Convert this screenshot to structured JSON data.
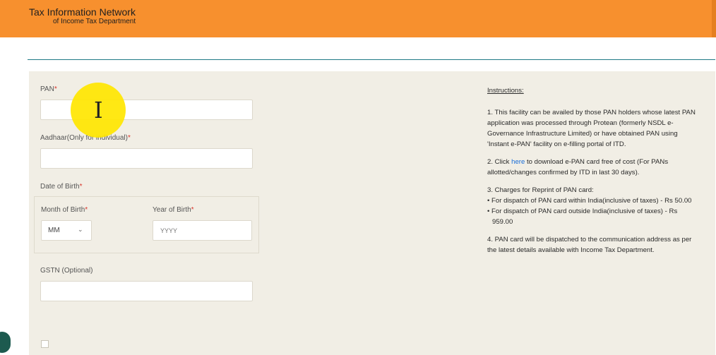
{
  "header": {
    "title": "Tax Information Network",
    "subtitle": "of Income Tax Department",
    "background_color": "#f7902e"
  },
  "form": {
    "pan_label": "PAN",
    "pan_value": "",
    "aadhaar_label": "Aadhaar(Only for individual)",
    "aadhaar_value": "",
    "dob_label": "Date of Birth",
    "month_label": "Month of Birth",
    "month_value": "MM",
    "year_label": "Year of Birth",
    "year_placeholder": "YYYY",
    "gstn_label": "GSTN (Optional)",
    "gstn_value": "",
    "required_mark": "*",
    "consent_checked": false
  },
  "instructions": {
    "title": "Instructions:",
    "item1": "1. This facility can be availed by those PAN holders whose latest PAN application was processed through Protean (formerly NSDL e-Governance Infrastructure Limited) or have obtained PAN using 'Instant e-PAN' facility on e-filling portal of ITD.",
    "item2_prefix": "2. Click ",
    "item2_link": "here",
    "item2_suffix": " to download e-PAN card free of cost (For PANs allotted/changes confirmed by ITD in last 30 days).",
    "item3_title": "3. Charges for Reprint of PAN card:",
    "item3_bullet1": "• For dispatch of PAN card within India(inclusive of taxes) - Rs 50.00",
    "item3_bullet2": "• For dispatch of PAN card outside India(inclusive of taxes) - Rs 959.00",
    "item4": "4. PAN card will be dispatched to the communication address as per the latest details available with Income Tax Department."
  },
  "cursor": {
    "icon": "i-beam-cursor-icon",
    "highlight_color": "#ffe600"
  }
}
